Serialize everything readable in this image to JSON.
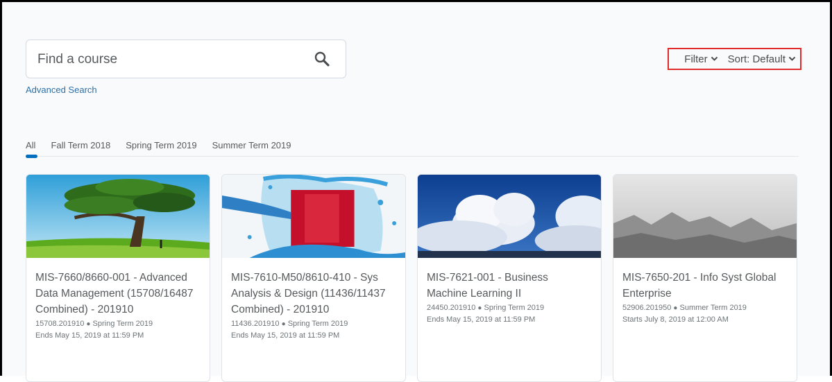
{
  "search": {
    "placeholder": "Find a course",
    "advanced_label": "Advanced Search"
  },
  "controls": {
    "filter_label": "Filter",
    "sort_label": "Sort: Default",
    "highlight_color": "#e02b2b"
  },
  "tabs": [
    {
      "label": "All",
      "selected": true
    },
    {
      "label": "Fall Term 2018"
    },
    {
      "label": "Spring Term 2019"
    },
    {
      "label": "Summer Term 2019"
    }
  ],
  "courses": [
    {
      "title": "MIS-7660/8660-001 - Advanced Data Management (15708/16487 Combined) - 201910",
      "code": "15708.201910",
      "term": "Spring Term 2019",
      "date": "Ends May 15, 2019 at 11:59 PM",
      "image": "tree-in-field-image"
    },
    {
      "title": "MIS-7610-M50/8610-410 - Sys Analysis & Design (11436/11437 Combined) - 201910",
      "code": "11436.201910",
      "term": "Spring Term 2019",
      "date": "Ends May 15, 2019 at 11:59 PM",
      "image": "red-liquid-splash-image"
    },
    {
      "title": "MIS-7621-001 - Business Machine Learning II",
      "code": "24450.201910",
      "term": "Spring Term 2019",
      "date": "Ends May 15, 2019 at 11:59 PM",
      "image": "clouds-sky-image"
    },
    {
      "title": "MIS-7650-201 - Info Syst Global Enterprise",
      "code": "52906.201950",
      "term": "Summer Term 2019",
      "date": "Starts July 8, 2019 at 12:00 AM",
      "image": "mountains-grayscale-image"
    }
  ],
  "colors": {
    "link": "#2b6fa8",
    "tab_indicator": "#006fbf",
    "text": "#56595b"
  }
}
